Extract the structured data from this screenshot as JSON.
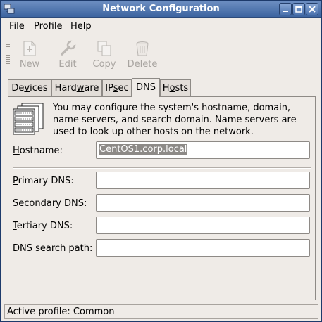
{
  "window": {
    "title": "Network Configuration"
  },
  "menu": [
    {
      "pre": "",
      "key": "F",
      "post": "ile"
    },
    {
      "pre": "",
      "key": "P",
      "post": "rofile"
    },
    {
      "pre": "",
      "key": "H",
      "post": "elp"
    }
  ],
  "toolbar": {
    "new_label": "New",
    "edit_label": "Edit",
    "copy_label": "Copy",
    "delete_label": "Delete"
  },
  "tabs": [
    {
      "pre": "De",
      "key": "v",
      "post": "ices",
      "active": false
    },
    {
      "pre": "Hard",
      "key": "w",
      "post": "are",
      "active": false
    },
    {
      "pre": "IP",
      "key": "s",
      "post": "ec",
      "active": false
    },
    {
      "pre": "D",
      "key": "N",
      "post": "S",
      "active": true
    },
    {
      "pre": "H",
      "key": "o",
      "post": "sts",
      "active": false
    }
  ],
  "dns": {
    "info": "You may configure the system's hostname, domain, name servers, and search domain. Name servers are used to look up other hosts on the network.",
    "hostname_label_key": "H",
    "hostname_label_rest": "ostname:",
    "hostname_value": "CentOS1.corp.local",
    "primary_key": "P",
    "primary_rest": "rimary DNS:",
    "primary_value": "",
    "secondary_key": "S",
    "secondary_rest": "econdary DNS:",
    "secondary_value": "",
    "tertiary_key": "T",
    "tertiary_rest": "ertiary DNS:",
    "tertiary_value": "",
    "search_label": "DNS search path:",
    "search_value": ""
  },
  "status": {
    "text": "Active profile: Common"
  },
  "colors": {
    "titlebar": "#3d64a0",
    "background": "#efebe7",
    "selection": "#8d8a87"
  }
}
